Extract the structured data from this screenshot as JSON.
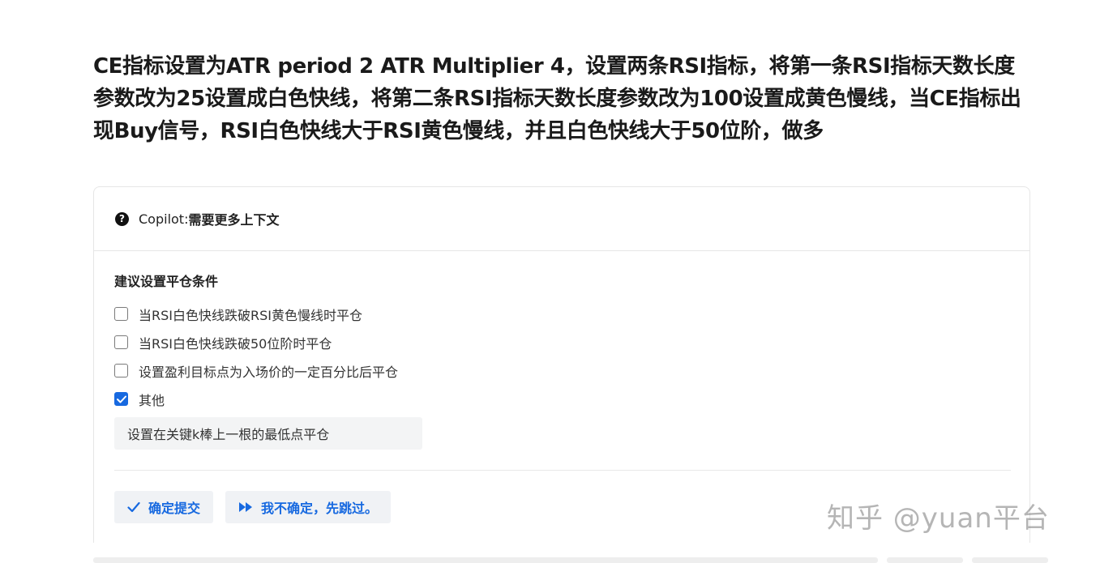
{
  "prompt_text": "CE指标设置为ATR period 2 ATR Multiplier 4，设置两条RSI指标，将第一条RSI指标天数长度参数改为25设置成白色快线，将第二条RSI指标天数长度参数改为100设置成黄色慢线，当CE指标出现Buy信号，RSI白色快线大于RSI黄色慢线，并且白色快线大于50位阶，做多",
  "card": {
    "header": {
      "icon": "question-circle-icon",
      "label": "Copilot: ",
      "title": "需要更多上下文"
    },
    "section_title": "建议设置平仓条件",
    "options": [
      {
        "label": "当RSI白色快线跌破RSI黄色慢线时平仓",
        "checked": false
      },
      {
        "label": "当RSI白色快线跌破50位阶时平仓",
        "checked": false
      },
      {
        "label": "设置盈利目标点为入场价的一定百分比后平仓",
        "checked": false
      },
      {
        "label": "其他",
        "checked": true
      }
    ],
    "other_input_value": "设置在关键k棒上一根的最低点平仓",
    "buttons": {
      "confirm": {
        "icon": "check-icon",
        "label": "确定提交"
      },
      "skip": {
        "icon": "fast-forward-icon",
        "label": "我不确定，先跳过。"
      }
    }
  },
  "watermark": "知乎 @yuan平台",
  "colors": {
    "accent": "#1769e0",
    "button_bg": "#f0f2f5",
    "input_bg": "#f3f4f5",
    "border": "#e6e6e6"
  }
}
